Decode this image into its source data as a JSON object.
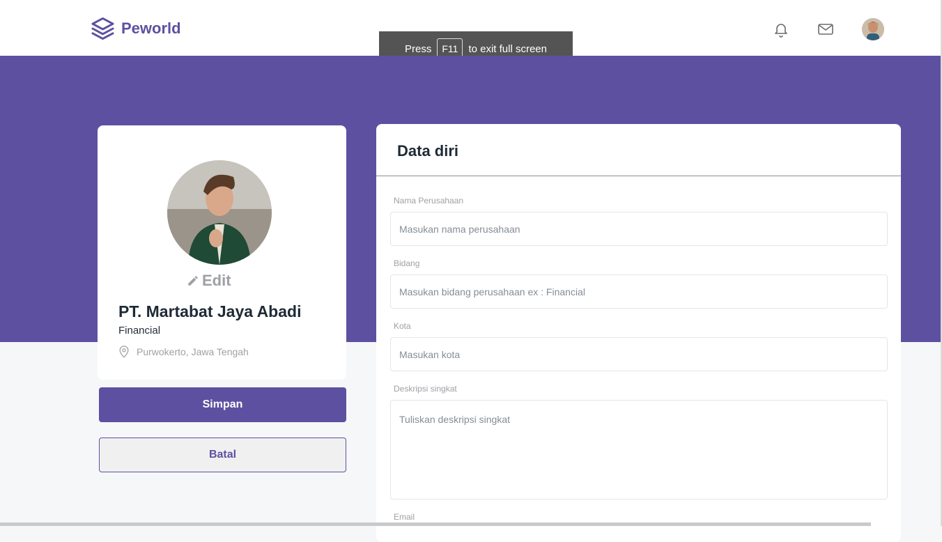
{
  "navbar": {
    "brand": "Peworld",
    "icons": [
      "bell-icon",
      "mail-icon"
    ]
  },
  "fullscreen_notice": {
    "prefix": "Press",
    "key": "F11",
    "suffix": "to exit full screen"
  },
  "profile": {
    "edit_label": "Edit",
    "company_name": "PT. Martabat Jaya Abadi",
    "field": "Financial",
    "location": "Purwokerto, Jawa Tengah"
  },
  "actions": {
    "save_label": "Simpan",
    "cancel_label": "Batal"
  },
  "form": {
    "title": "Data diri",
    "fields": [
      {
        "label": "Nama Perusahaan",
        "placeholder": "Masukan nama perusahaan"
      },
      {
        "label": "Bidang",
        "placeholder": "Masukan bidang perusahaan ex : Financial"
      },
      {
        "label": "Kota",
        "placeholder": "Masukan kota"
      },
      {
        "label": "Deskripsi singkat",
        "placeholder": "Tuliskan deskripsi singkat"
      },
      {
        "label": "Email"
      }
    ]
  },
  "colors": {
    "brand": "#5E50A1",
    "page_bg": "#F6F7F8"
  }
}
